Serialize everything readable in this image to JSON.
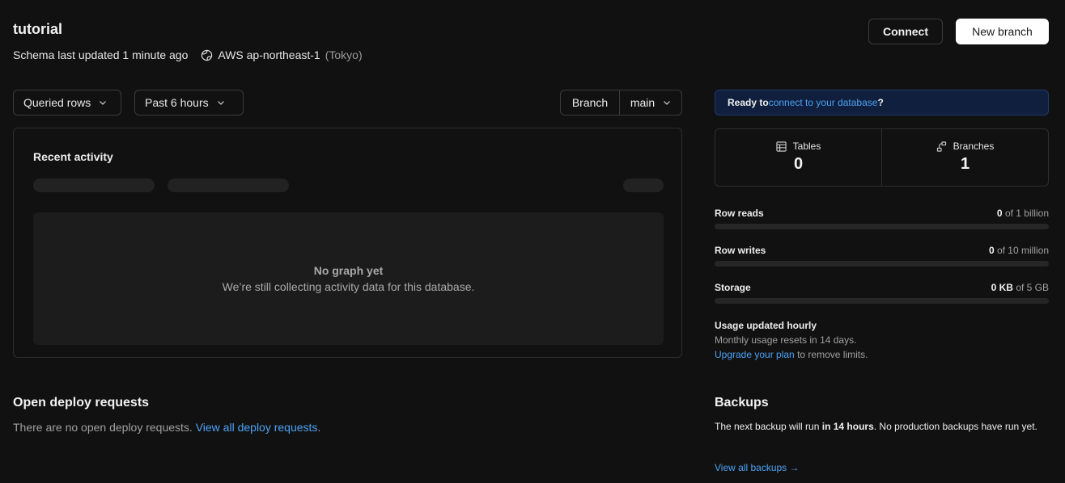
{
  "header": {
    "title": "tutorial",
    "schema_updated": "Schema last updated 1 minute ago",
    "region": "AWS ap-northeast-1",
    "region_city": "(Tokyo)",
    "connect_label": "Connect",
    "new_branch_label": "New branch"
  },
  "filters": {
    "metric": "Queried rows",
    "range": "Past 6 hours",
    "branch_label": "Branch",
    "branch_value": "main"
  },
  "activity": {
    "title": "Recent activity",
    "empty_title": "No graph yet",
    "empty_text": "We’re still collecting activity data for this database."
  },
  "banner": {
    "prefix": "Ready to ",
    "link": "connect to your database",
    "suffix": "?"
  },
  "stats": {
    "tables_label": "Tables",
    "tables_value": "0",
    "branches_label": "Branches",
    "branches_value": "1"
  },
  "usage": [
    {
      "name": "Row reads",
      "used": "0",
      "limit": "of 1 billion",
      "fraction": 0
    },
    {
      "name": "Row writes",
      "used": "0",
      "limit": "of 10 million",
      "fraction": 0
    },
    {
      "name": "Storage",
      "used": "0 KB",
      "limit": "of 5 GB",
      "fraction": 0
    }
  ],
  "usage_note": {
    "title": "Usage updated hourly",
    "reset": "Monthly usage resets in 14 days.",
    "upgrade_link": "Upgrade your plan",
    "upgrade_suffix": " to remove limits."
  },
  "deploy": {
    "title": "Open deploy requests",
    "text": "There are no open deploy requests. ",
    "link": "View all deploy requests",
    "suffix": "."
  },
  "backups": {
    "title": "Backups",
    "text_prefix": "The next backup will run ",
    "text_bold": "in 14 hours",
    "text_suffix": ". No production backups have run yet.",
    "link": "View all backups →"
  },
  "colors": {
    "background": "#111111",
    "accent": "#4ca3f5",
    "banner_bg": "#0f1f3d"
  }
}
